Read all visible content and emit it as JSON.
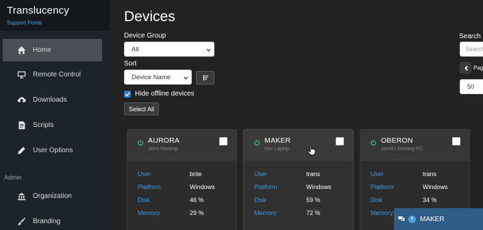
{
  "brand": {
    "title": "Translucency",
    "subtitle": "Support Portal"
  },
  "sidebar": {
    "items": [
      {
        "label": "Home",
        "icon": "home-icon",
        "active": true
      },
      {
        "label": "Remote Control",
        "icon": "monitor-icon"
      },
      {
        "label": "Downloads",
        "icon": "cloud-download-icon"
      },
      {
        "label": "Scripts",
        "icon": "scripts-icon"
      },
      {
        "label": "User Options",
        "icon": "pencil-icon"
      }
    ],
    "admin_heading": "Admin",
    "admin_items": [
      {
        "label": "Organization",
        "icon": "organization-icon"
      },
      {
        "label": "Branding",
        "icon": "brush-icon"
      }
    ]
  },
  "main": {
    "title": "Devices",
    "device_group_label": "Device Group",
    "device_group_value": "All",
    "sort_label": "Sort",
    "sort_value": "Device Name",
    "hide_offline_label": "Hide offline devices",
    "hide_offline_checked": true,
    "select_all_label": "Select All",
    "search_label": "Search",
    "search_placeholder": "Search",
    "page_label": "Page",
    "page_size_value": "50"
  },
  "device_fields": {
    "user": "User",
    "platform": "Platform",
    "disk": "Disk",
    "memory": "Memory"
  },
  "devices": [
    {
      "name": "AURORA",
      "alias": "Jen's Desktop",
      "user": "brite",
      "platform": "Windows",
      "disk": "46 %",
      "memory": "29 %",
      "online": true
    },
    {
      "name": "MAKER",
      "alias": "Dev Laptop",
      "user": "trans",
      "platform": "Windows",
      "disk": "59 %",
      "memory": "72 %",
      "online": true
    },
    {
      "name": "OBERON",
      "alias": "Jared's Gaming PC",
      "user": "trans",
      "platform": "Windows",
      "disk": "34 %",
      "memory": "",
      "online": true
    }
  ],
  "chat": {
    "badge": "0",
    "name": "MAKER"
  },
  "colors": {
    "accent": "#3f9be0",
    "online": "#3fbf6a",
    "sidebar_bg": "#1d232b",
    "main_bg": "#222222",
    "chat_bg": "#2f5d85"
  }
}
